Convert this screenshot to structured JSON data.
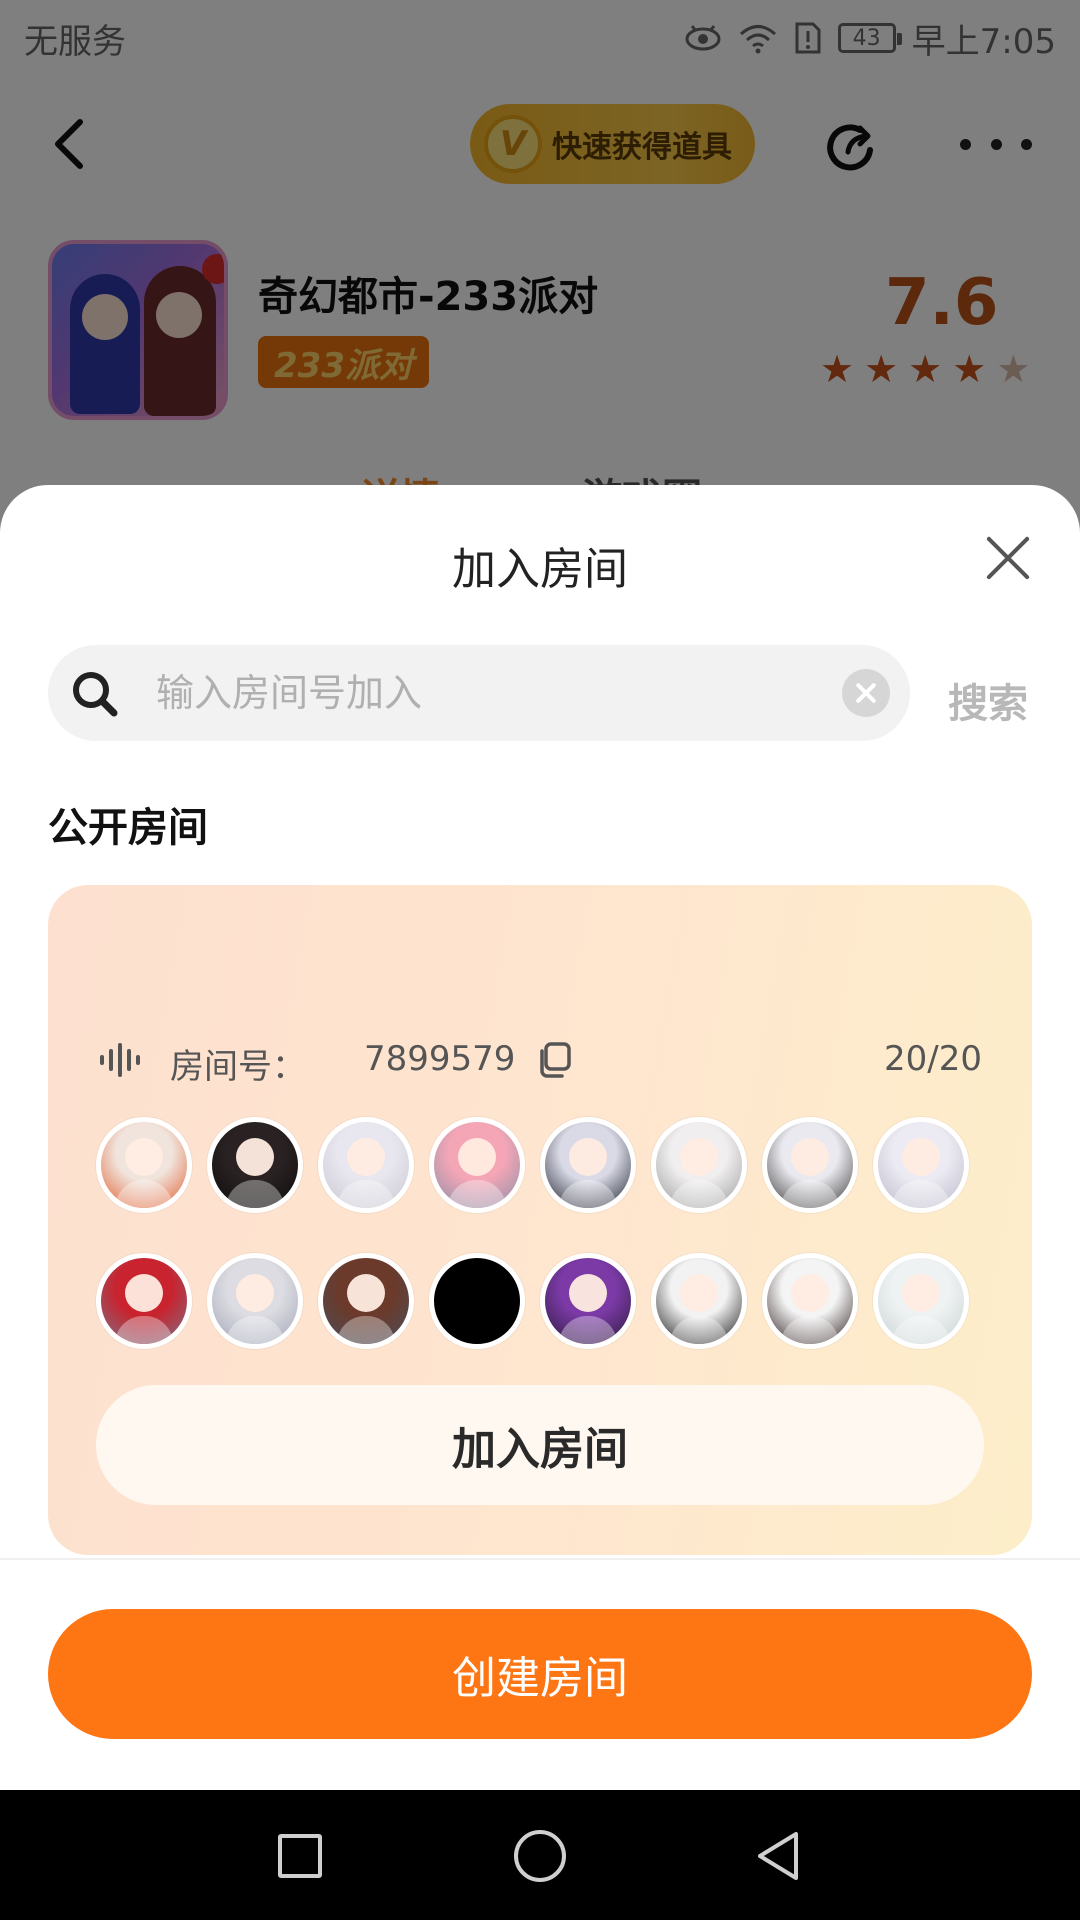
{
  "status_bar": {
    "carrier": "无服务",
    "battery": "43",
    "time": "早上7:05",
    "icons": [
      "eye-icon",
      "wifi-icon",
      "alert-icon",
      "battery-icon"
    ]
  },
  "top_nav": {
    "promo_label": "快速获得道具",
    "promo_badge": "V"
  },
  "game": {
    "title": "奇幻都市-233派对",
    "tag": "233派对",
    "score": "7.6",
    "stars": 4
  },
  "tabs": [
    "详情",
    "游戏圈"
  ],
  "sheet": {
    "title": "加入房间",
    "search": {
      "placeholder": "输入房间号加入",
      "value": "",
      "button_label": "搜索"
    },
    "section_title": "公开房间",
    "room": {
      "id_label": "房间号：",
      "id": "7899579",
      "count": "20/20",
      "join_label": "加入房间",
      "avatars": [
        {
          "colors": [
            "#f0e4dc",
            "#e05a2a"
          ]
        },
        {
          "colors": [
            "#2a2222",
            "#0c0c0c"
          ]
        },
        {
          "colors": [
            "#e8e6ee",
            "#c8c6d0"
          ]
        },
        {
          "colors": [
            "#f4a6b6",
            "#8a8fa8"
          ]
        },
        {
          "colors": [
            "#d9dae6",
            "#1a1d2a"
          ]
        },
        {
          "colors": [
            "#f0eeee",
            "#9a9a9a"
          ]
        },
        {
          "colors": [
            "#e9e9ef",
            "#353535"
          ]
        },
        {
          "colors": [
            "#eceaf2",
            "#b9b8c8"
          ]
        },
        {
          "colors": [
            "#c8232e",
            "#7a7488"
          ]
        },
        {
          "colors": [
            "#dcdce2",
            "#9fa4b5"
          ]
        },
        {
          "colors": [
            "#6b3a2a",
            "#4a4e5c"
          ]
        },
        {
          "colors": [
            "#000000",
            "#000000"
          ],
          "solid": true
        },
        {
          "colors": [
            "#7b3aa6",
            "#2a1a3a"
          ]
        },
        {
          "colors": [
            "#f2f2f2",
            "#111111"
          ]
        },
        {
          "colors": [
            "#f4f4f4",
            "#2a1a1a"
          ]
        },
        {
          "colors": [
            "#eef2f2",
            "#c9d2d4"
          ]
        }
      ]
    },
    "create_label": "创建房间"
  },
  "colors": {
    "accent": "#fe7514",
    "score": "#b8521a",
    "room_card_start": "#fde0cf",
    "room_card_end": "#fdeec9"
  }
}
